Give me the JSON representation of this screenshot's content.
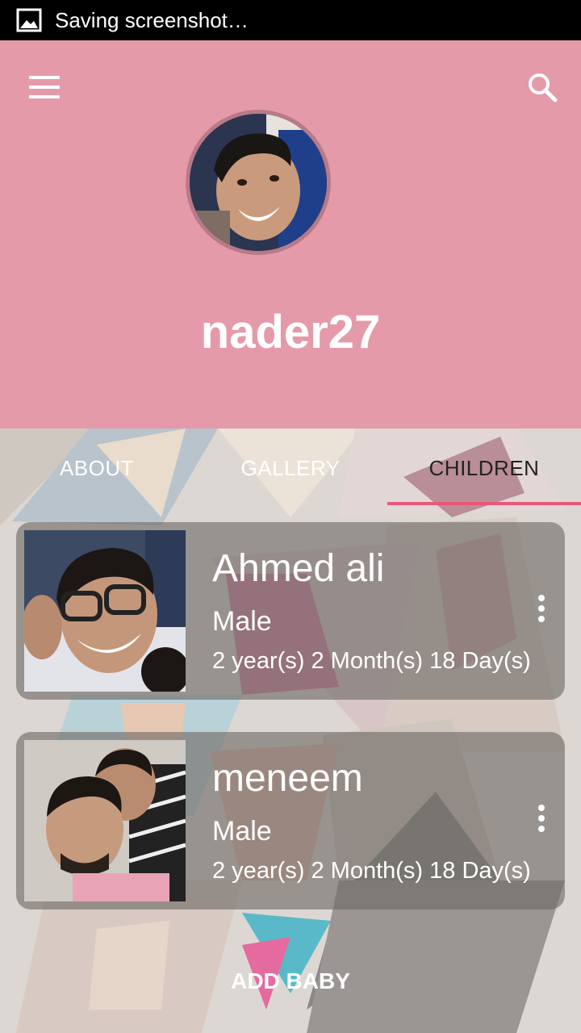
{
  "status_bar": {
    "text": "Saving screenshot…",
    "icon": "image-icon"
  },
  "header": {
    "menu_icon": "hamburger-menu-icon",
    "search_icon": "search-icon",
    "username": "nader27",
    "background_color": "#e59aa9"
  },
  "tabs": [
    {
      "label": "ABOUT",
      "active": false
    },
    {
      "label": "GALLERY",
      "active": false
    },
    {
      "label": "CHILDREN",
      "active": true
    }
  ],
  "accent_color": "#e8587c",
  "children": [
    {
      "name": "Ahmed ali",
      "gender": "Male",
      "age": "2 year(s) 2 Month(s) 18 Day(s)",
      "menu_icon": "more-vert-icon"
    },
    {
      "name": "meneem",
      "gender": "Male",
      "age": "2 year(s) 2 Month(s) 18 Day(s)",
      "menu_icon": "more-vert-icon"
    }
  ],
  "add_baby_label": "ADD BABY"
}
